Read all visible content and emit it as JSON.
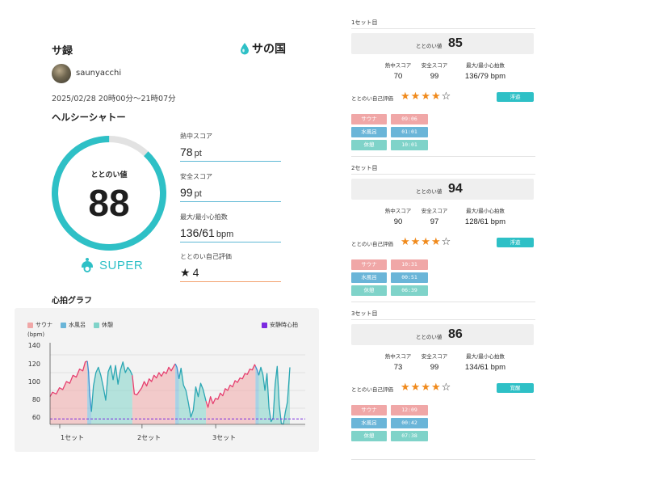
{
  "header": {
    "title": "サ録",
    "logo_text": "サの国"
  },
  "user": {
    "name": "saunyacchi"
  },
  "session": {
    "datetime": "2025/02/28 20時00分〜21時07分"
  },
  "summary": {
    "facility": "ヘルシーシャトー",
    "totonoi_label": "ととのい値",
    "totonoi_value": "88",
    "totonoi_score": 88,
    "rank": "SUPER",
    "metrics": [
      {
        "label": "熱中スコア",
        "value": "78",
        "unit": "pt"
      },
      {
        "label": "安全スコア",
        "value": "99",
        "unit": "pt"
      },
      {
        "label": "最大/最小心拍数",
        "value": "136/61",
        "unit": "bpm"
      },
      {
        "label": "ととのい自己評価",
        "value": "4",
        "unit": ""
      }
    ]
  },
  "graph": {
    "title": "心拍グラフ",
    "legend": {
      "sauna": "サウナ",
      "water": "水風呂",
      "rest": "休憩",
      "resting_hr": "安静時心拍"
    },
    "unit": "(bpm)"
  },
  "chart_data": {
    "type": "line",
    "ylabel": "(bpm)",
    "ylim": [
      55,
      142
    ],
    "y_ticks": [
      "140",
      "120",
      "100",
      "80",
      "60"
    ],
    "x_labels": [
      "1セット",
      "2セット",
      "3セット"
    ],
    "resting_hr": 68,
    "phase_colors": {
      "sauna": "#f0a7a7",
      "water": "#6ab5d8",
      "rest": "#7fd3c9",
      "line": "#e63f6f",
      "rest_line": "#2aa6b3",
      "resting": "#7b2ae0"
    },
    "phases": [
      {
        "type": "sauna",
        "start": 0,
        "end": 9.1
      },
      {
        "type": "water",
        "start": 9.1,
        "end": 10.1
      },
      {
        "type": "rest",
        "start": 10.1,
        "end": 20.1
      },
      {
        "type": "sauna",
        "start": 20.1,
        "end": 30.6
      },
      {
        "type": "water",
        "start": 30.6,
        "end": 31.5
      },
      {
        "type": "rest",
        "start": 31.5,
        "end": 38.1
      },
      {
        "type": "sauna",
        "start": 38.1,
        "end": 50.2
      },
      {
        "type": "water",
        "start": 50.2,
        "end": 51.0
      },
      {
        "type": "rest",
        "start": 51.0,
        "end": 58.6
      }
    ],
    "points": [
      [
        0,
        93
      ],
      [
        0.6,
        98
      ],
      [
        1.5,
        96
      ],
      [
        2.3,
        103
      ],
      [
        3.1,
        101
      ],
      [
        4.0,
        110
      ],
      [
        4.8,
        108
      ],
      [
        5.6,
        117
      ],
      [
        6.4,
        115
      ],
      [
        7.2,
        124
      ],
      [
        8.0,
        122
      ],
      [
        8.6,
        132
      ],
      [
        9.1,
        133
      ],
      [
        9.4,
        121
      ],
      [
        9.7,
        95
      ],
      [
        10.1,
        76
      ],
      [
        10.6,
        105
      ],
      [
        11.2,
        120
      ],
      [
        11.8,
        126
      ],
      [
        12.4,
        117
      ],
      [
        13.0,
        104
      ],
      [
        13.6,
        89
      ],
      [
        14.2,
        121
      ],
      [
        14.8,
        128
      ],
      [
        15.4,
        112
      ],
      [
        16.0,
        128
      ],
      [
        16.6,
        107
      ],
      [
        17.2,
        123
      ],
      [
        17.8,
        132
      ],
      [
        18.4,
        120
      ],
      [
        19.0,
        126
      ],
      [
        19.6,
        122
      ],
      [
        20.1,
        117
      ],
      [
        20.6,
        96
      ],
      [
        21.2,
        95
      ],
      [
        21.8,
        99
      ],
      [
        22.4,
        103
      ],
      [
        23.0,
        110
      ],
      [
        23.6,
        105
      ],
      [
        24.2,
        113
      ],
      [
        24.8,
        110
      ],
      [
        25.4,
        117
      ],
      [
        26.0,
        114
      ],
      [
        26.6,
        120
      ],
      [
        27.2,
        116
      ],
      [
        27.8,
        121
      ],
      [
        28.4,
        119
      ],
      [
        29.0,
        126
      ],
      [
        29.6,
        122
      ],
      [
        30.2,
        127
      ],
      [
        30.6,
        130
      ],
      [
        31.0,
        126
      ],
      [
        31.5,
        113
      ],
      [
        32.0,
        125
      ],
      [
        32.6,
        106
      ],
      [
        33.2,
        100
      ],
      [
        33.8,
        86
      ],
      [
        34.4,
        70
      ],
      [
        35.0,
        78
      ],
      [
        35.6,
        104
      ],
      [
        36.2,
        93
      ],
      [
        36.8,
        108
      ],
      [
        37.4,
        101
      ],
      [
        38.1,
        88
      ],
      [
        38.6,
        81
      ],
      [
        39.2,
        93
      ],
      [
        39.8,
        85
      ],
      [
        40.4,
        91
      ],
      [
        41.0,
        90
      ],
      [
        41.6,
        97
      ],
      [
        42.2,
        94
      ],
      [
        42.8,
        102
      ],
      [
        43.4,
        100
      ],
      [
        44.0,
        106
      ],
      [
        44.6,
        104
      ],
      [
        45.2,
        111
      ],
      [
        45.8,
        109
      ],
      [
        46.4,
        114
      ],
      [
        47.0,
        113
      ],
      [
        47.6,
        119
      ],
      [
        48.2,
        118
      ],
      [
        48.8,
        124
      ],
      [
        49.4,
        123
      ],
      [
        50.0,
        129
      ],
      [
        50.2,
        127
      ],
      [
        50.6,
        123
      ],
      [
        51.0,
        117
      ],
      [
        51.5,
        126
      ],
      [
        52.0,
        118
      ],
      [
        52.5,
        100
      ],
      [
        53.0,
        119
      ],
      [
        53.5,
        80
      ],
      [
        54.0,
        65
      ],
      [
        54.5,
        69
      ],
      [
        55.0,
        107
      ],
      [
        55.5,
        127
      ],
      [
        56.0,
        84
      ],
      [
        56.5,
        63
      ],
      [
        57.0,
        62
      ],
      [
        57.5,
        76
      ],
      [
        58.0,
        87
      ],
      [
        58.6,
        126
      ]
    ]
  },
  "sets": [
    {
      "title": "1セット目",
      "totonoi_label": "ととのい値",
      "totonoi_value": "85",
      "headers": [
        "熱中スコア",
        "安全スコア",
        "最大/最小心拍数"
      ],
      "values": [
        "70",
        "99",
        "136/79 bpm"
      ],
      "rating_label": "ととのい自己評価",
      "rating": 4,
      "rating_max": 5,
      "tag": "浮遊",
      "phases": [
        {
          "type": "sauna",
          "name": "サウナ",
          "time": "09:06"
        },
        {
          "type": "water",
          "name": "水風呂",
          "time": "01:01"
        },
        {
          "type": "rest",
          "name": "休憩",
          "time": "10:01"
        }
      ]
    },
    {
      "title": "2セット目",
      "totonoi_label": "ととのい値",
      "totonoi_value": "94",
      "headers": [
        "熱中スコア",
        "安全スコア",
        "最大/最小心拍数"
      ],
      "values": [
        "90",
        "97",
        "128/61 bpm"
      ],
      "rating_label": "ととのい自己評価",
      "rating": 4,
      "rating_max": 5,
      "tag": "浮遊",
      "phases": [
        {
          "type": "sauna",
          "name": "サウナ",
          "time": "10:31"
        },
        {
          "type": "water",
          "name": "水風呂",
          "time": "00:51"
        },
        {
          "type": "rest",
          "name": "休憩",
          "time": "06:39"
        }
      ]
    },
    {
      "title": "3セット目",
      "totonoi_label": "ととのい値",
      "totonoi_value": "86",
      "headers": [
        "熱中スコア",
        "安全スコア",
        "最大/最小心拍数"
      ],
      "values": [
        "73",
        "99",
        "134/61 bpm"
      ],
      "rating_label": "ととのい自己評価",
      "rating": 4,
      "rating_max": 5,
      "tag": "覚醒",
      "phases": [
        {
          "type": "sauna",
          "name": "サウナ",
          "time": "12:09"
        },
        {
          "type": "water",
          "name": "水風呂",
          "time": "00:42"
        },
        {
          "type": "rest",
          "name": "休憩",
          "time": "07:38"
        }
      ]
    }
  ]
}
